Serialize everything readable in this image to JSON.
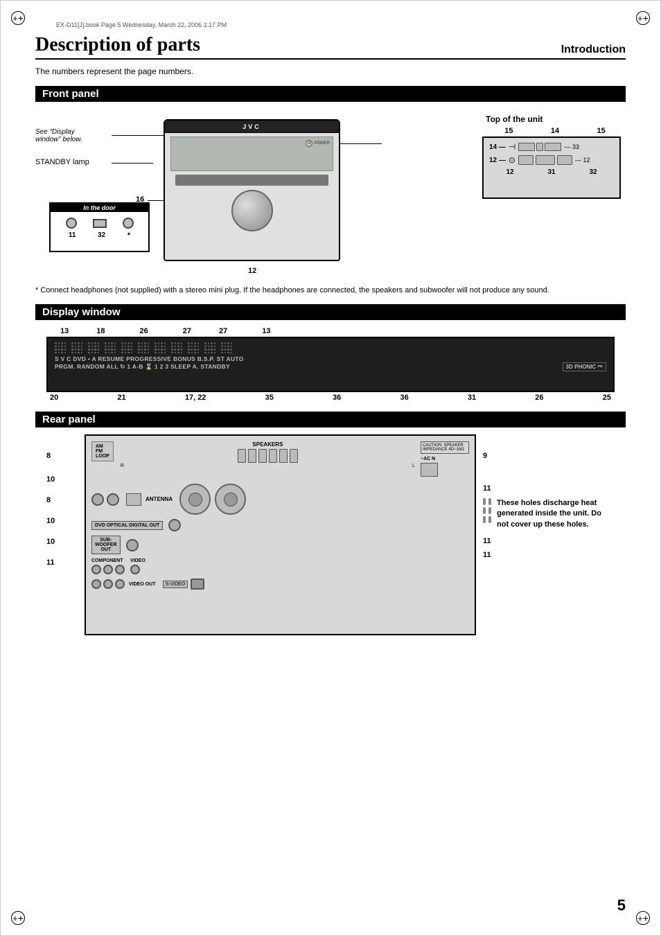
{
  "page": {
    "title": "Description of parts",
    "section": "Introduction",
    "page_number": "5",
    "metadata": "EX-D11[J].book  Page 5  Wednesday, March 22, 2006  1:17 PM",
    "intro_text": "The numbers represent the page numbers."
  },
  "front_panel": {
    "header": "Front panel",
    "see_display_label": "See “Display",
    "see_display_label2": "window” below.",
    "standby_label": "STANDBY lamp",
    "in_door_label": "In the door",
    "device_brand": "JVC",
    "number_16": "16",
    "number_12_bottom": "12",
    "number_11": "11",
    "number_32_door": "32",
    "number_12_side": "12",
    "number_14": "14",
    "number_12_top1": "12",
    "number_31": "31",
    "number_32_top": "32",
    "number_33": "33",
    "number_12_top2": "12",
    "top_unit_label": "Top of the unit",
    "top_numbers_row1": "15   14   15",
    "top_numbers_row2": "12   31   32"
  },
  "display_window": {
    "header": "Display window",
    "numbers_top": [
      "13",
      "18",
      "26",
      "27",
      "27",
      "13"
    ],
    "numbers_bottom": [
      "20",
      "21",
      "17, 22",
      "35",
      "36",
      "36",
      "31",
      "26",
      "25"
    ],
    "display_text_line1": "S V C DVD • A  RESUME  PROGRESSIVE  BONUS  B.S.P. ST AUTO",
    "display_text_line2": "PRGM. RANDOM ALL ↻ 1 A-B ⌛ 1 2 3 SLEEP A. STANDBY",
    "display_3d_phonic": "3D PHONIC",
    "display_speaker_icon": "ᵐᵉ"
  },
  "rear_panel": {
    "header": "Rear panel",
    "numbers_left": [
      "8",
      "10",
      "8",
      "10",
      "10",
      "11"
    ],
    "numbers_right_top": "9",
    "numbers_right_mid": "11",
    "numbers_right_mid2": "11",
    "numbers_right_bot": "11",
    "heat_note": "These holes discharge heat generated inside the unit. Do not cover up these holes.",
    "antenna_label": "ANTENNA",
    "speakers_label": "SPEAKERS",
    "caution_label": "CAUTION: SPEAKER IMPEDANCE 4Ω~16Ω",
    "dvd_optical_label": "DVD OPTICAL DIGITAL OUT",
    "subwoofer_label": "SUB-WOOFER OUT",
    "component_label": "COMPONENT",
    "video_out_label": "VIDEO OUT",
    "s_video_label": "S-VIDEO"
  },
  "footnote": {
    "text": "*  Connect headphones (not supplied) with a stereo mini plug. If the headphones are connected, the speakers and subwoofer will not produce any sound."
  },
  "icons": {
    "crosshair": "⊕",
    "registration_mark": "+"
  }
}
